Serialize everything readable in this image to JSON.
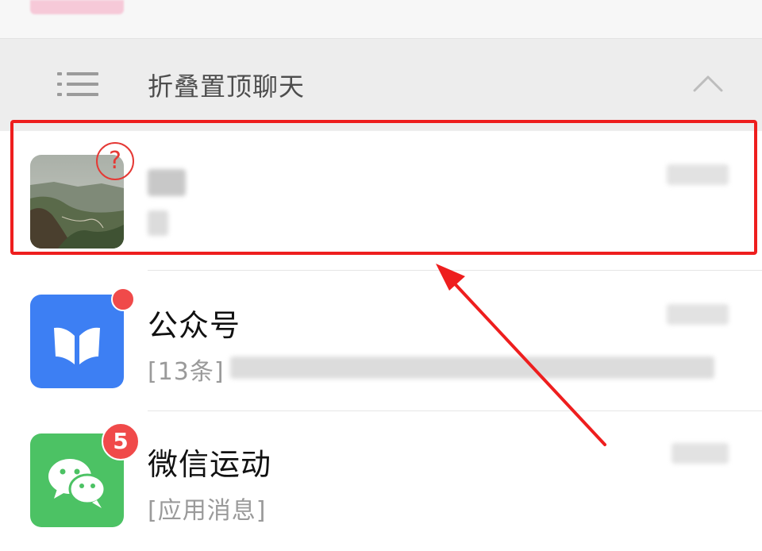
{
  "folded_section": {
    "label": "折叠置顶聊天",
    "list_icon": "list-icon",
    "collapse_icon": "chevron-up-icon"
  },
  "chats": [
    {
      "id": "pinned-chat",
      "avatar": "landscape-photo-avatar",
      "title": "",
      "subtitle": "",
      "time": "",
      "badge": "?",
      "highlight_color": "#ee1e1e"
    },
    {
      "id": "official-accounts",
      "avatar": "official-accounts-icon",
      "title": "公众号",
      "subtitle_prefix": "[13条]",
      "time": "",
      "badge": "red-dot",
      "avatar_color": "#3d7ff3"
    },
    {
      "id": "wechat-sports",
      "avatar": "wechat-chat-icon",
      "title": "微信运动",
      "subtitle": "[应用消息]",
      "time": "",
      "badge": "5",
      "avatar_color": "#4cc264"
    }
  ],
  "colors": {
    "badge_red": "#f04a4a",
    "fold_bar_bg": "#ededed",
    "annotation_red": "#ee1e1e"
  }
}
